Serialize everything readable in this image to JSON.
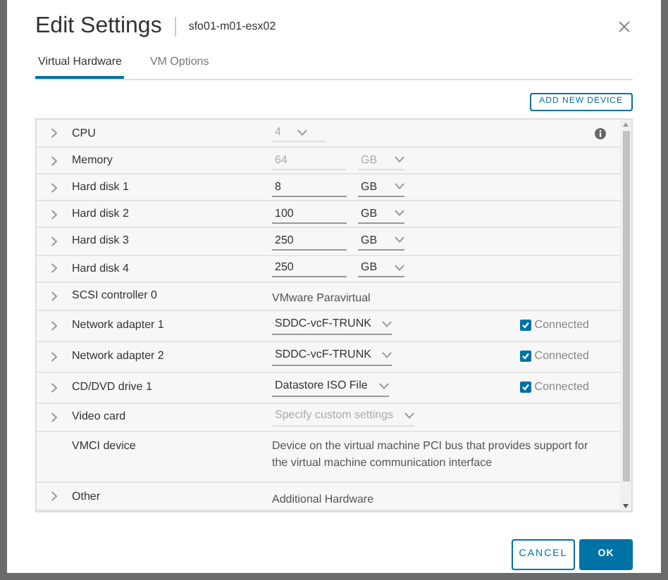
{
  "dialog": {
    "title": "Edit Settings",
    "subtitle": "sfo01-m01-esx02"
  },
  "tabs": [
    {
      "label": "Virtual Hardware",
      "selected": true
    },
    {
      "label": "VM Options",
      "selected": false
    }
  ],
  "add_button": "ADD NEW DEVICE",
  "rows": [
    {
      "kind": "number",
      "label": "CPU",
      "value": "4",
      "disabled": true,
      "info": true
    },
    {
      "kind": "number_unit",
      "label": "Memory",
      "value": "64",
      "unit": "GB",
      "disabled": true
    },
    {
      "kind": "number_unit",
      "label": "Hard disk 1",
      "value": "8",
      "unit": "GB",
      "disabled": false
    },
    {
      "kind": "number_unit",
      "label": "Hard disk 2",
      "value": "100",
      "unit": "GB",
      "disabled": false
    },
    {
      "kind": "number_unit",
      "label": "Hard disk 3",
      "value": "250",
      "unit": "GB",
      "disabled": false
    },
    {
      "kind": "number_unit",
      "label": "Hard disk 4",
      "value": "250",
      "unit": "GB",
      "disabled": false
    },
    {
      "kind": "text",
      "label": "SCSI controller 0",
      "value": "VMware Paravirtual"
    },
    {
      "kind": "select_check",
      "label": "Network adapter 1",
      "value": "SDDC-vcF-TRUNK",
      "check_label": "Connected",
      "checked": true
    },
    {
      "kind": "select_check",
      "label": "Network adapter 2",
      "value": "SDDC-vcF-TRUNK",
      "check_label": "Connected",
      "checked": true
    },
    {
      "kind": "select_check",
      "label": "CD/DVD drive 1",
      "value": "Datastore ISO File",
      "check_label": "Connected",
      "checked": true
    },
    {
      "kind": "select",
      "label": "Video card",
      "value": "Specify custom settings",
      "disabled": true
    },
    {
      "kind": "description",
      "label": "VMCI device",
      "value": "Device on the virtual machine PCI bus that provides support for the virtual machine communication interface"
    },
    {
      "kind": "text",
      "label": "Other",
      "value": "Additional Hardware"
    }
  ],
  "buttons": [
    {
      "label": "CANCEL",
      "kind": "secondary"
    },
    {
      "label": "OK",
      "kind": "primary"
    }
  ]
}
